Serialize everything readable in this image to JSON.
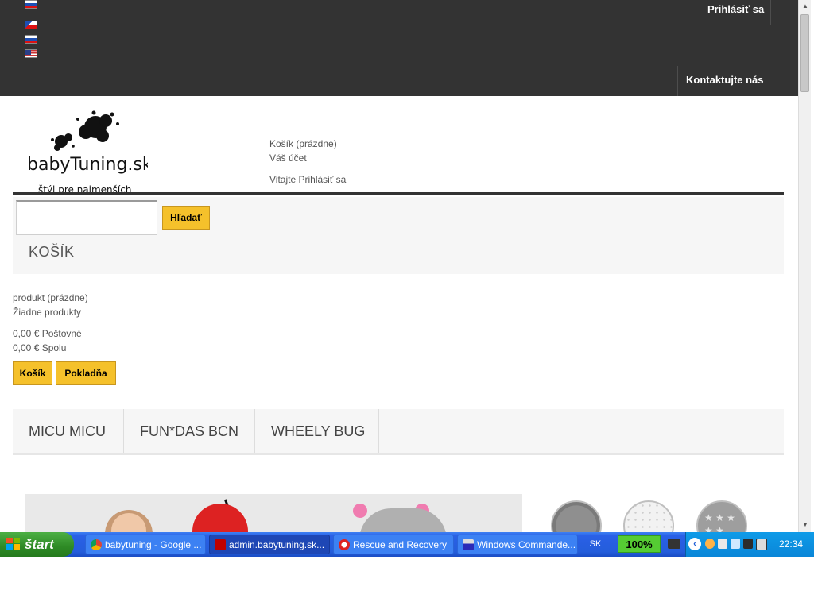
{
  "languages": [
    {
      "code": "sk",
      "icon": "flag-sk-icon"
    },
    {
      "code": "cz",
      "icon": "flag-cz-icon"
    },
    {
      "code": "sk",
      "icon": "flag-sk-icon"
    },
    {
      "code": "en",
      "icon": "flag-us-icon"
    }
  ],
  "topbar": {
    "login_label": "Prihlásiť sa",
    "contact_label": "Kontaktujte nás"
  },
  "logo": {
    "name": "babyTuning.sk",
    "tagline": "štýl pre najmenších"
  },
  "header": {
    "cart_label": "Košík (prázdne)",
    "account_label": "Váš účet",
    "welcome_label": "Vitajte",
    "welcome_login": "Prihlásiť sa"
  },
  "search": {
    "value": "",
    "button_label": "Hľadať"
  },
  "cart": {
    "heading": "KOŠÍK",
    "products_label": "produkt (prázdne)",
    "no_products": "Žiadne produkty",
    "shipping_label": "0,00 € Poštovné",
    "total_label": "0,00 € Spolu",
    "cart_button": "Košík",
    "checkout_button": "Pokladňa"
  },
  "menu": {
    "items": [
      "MICU MICU",
      "FUN*DAS BCN",
      "WHEELY BUG"
    ]
  },
  "taskbar": {
    "start_label": "štart",
    "tasks": [
      {
        "label": "babytuning - Google ...",
        "icon": "chrome-icon"
      },
      {
        "label": "admin.babytuning.sk...",
        "icon": "filezilla-icon"
      },
      {
        "label": "Rescue and Recovery",
        "icon": "rescue-icon"
      },
      {
        "label": "Windows Commande...",
        "icon": "floppy-icon"
      }
    ],
    "language": "SK",
    "zoom": "100%",
    "clock": "22:34"
  }
}
